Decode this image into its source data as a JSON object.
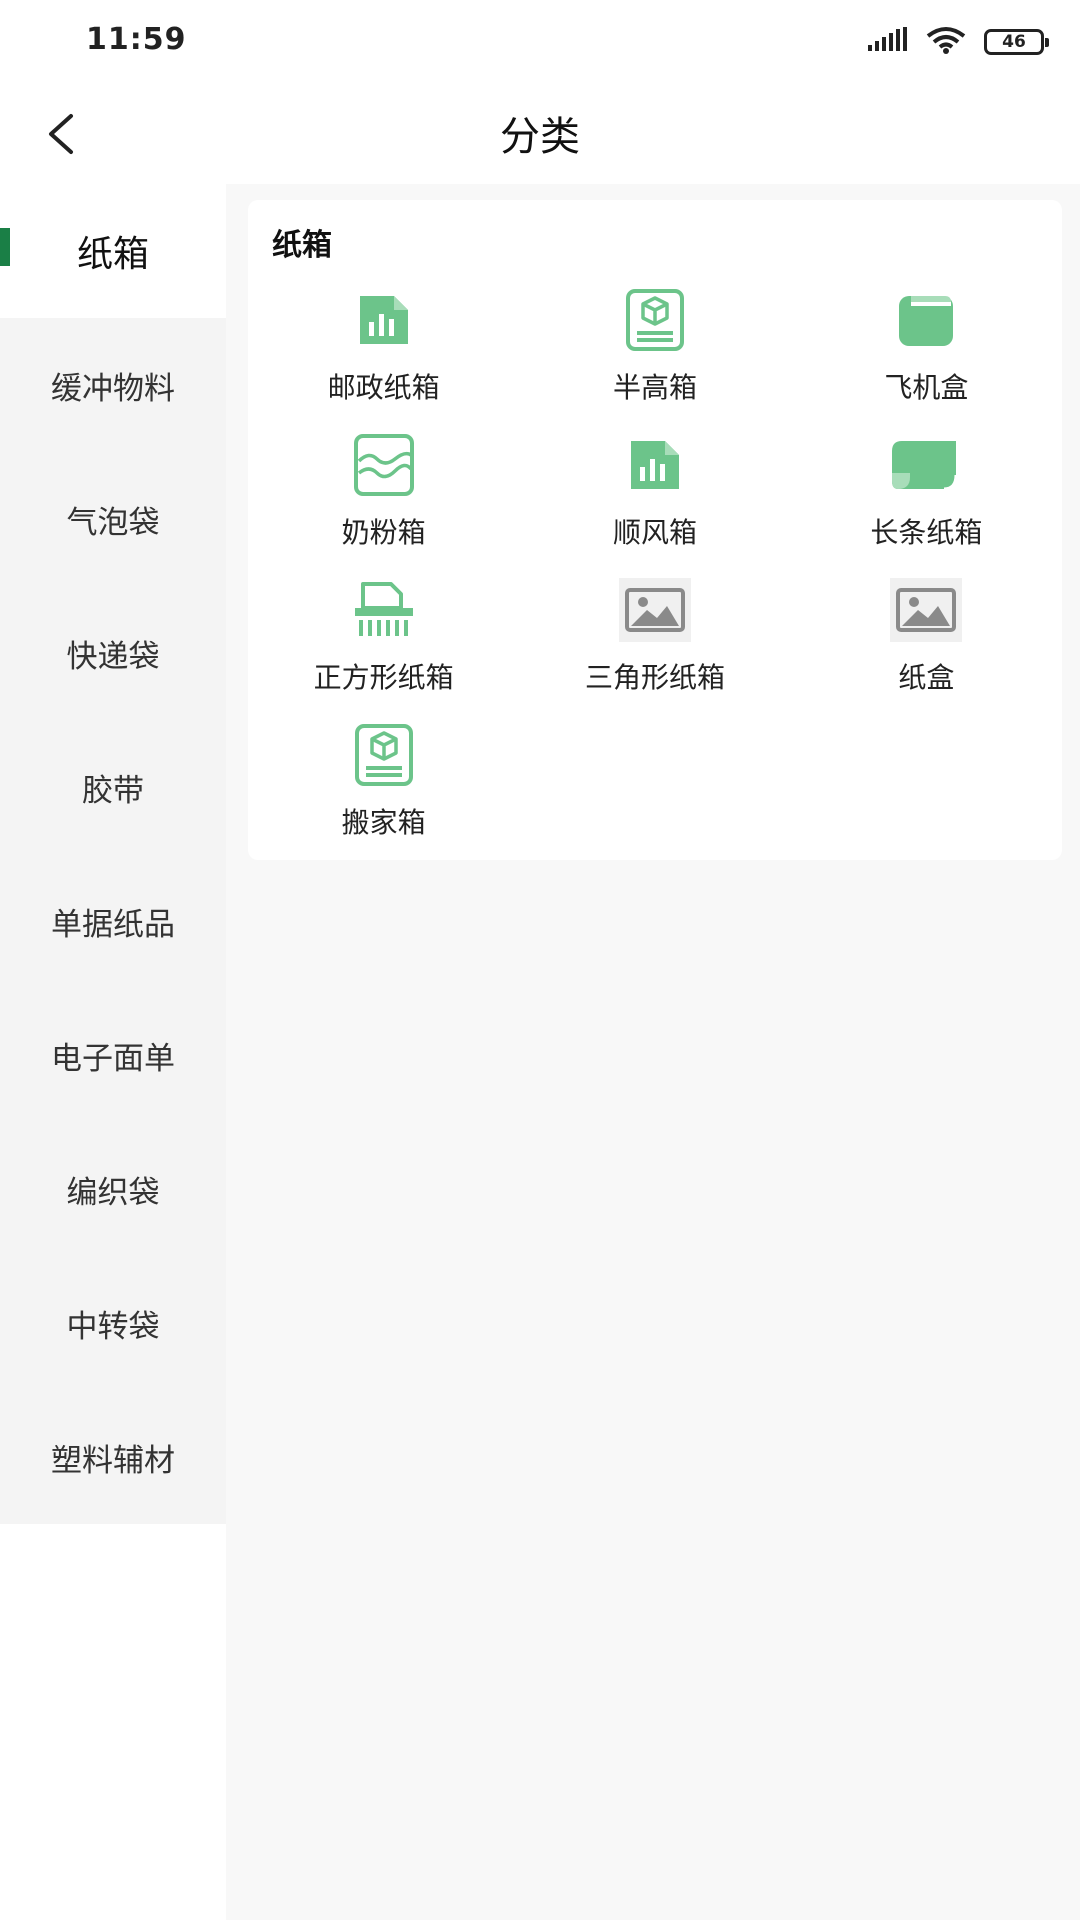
{
  "status_bar": {
    "time": "11:59",
    "battery": "46"
  },
  "header": {
    "title": "分类"
  },
  "sidebar": {
    "items": [
      {
        "label": "纸箱"
      },
      {
        "label": "缓冲物料"
      },
      {
        "label": "气泡袋"
      },
      {
        "label": "快递袋"
      },
      {
        "label": "胶带"
      },
      {
        "label": "单据纸品"
      },
      {
        "label": "电子面单"
      },
      {
        "label": "编织袋"
      },
      {
        "label": "中转袋"
      },
      {
        "label": "塑料辅材"
      }
    ]
  },
  "category": {
    "title": "纸箱",
    "items": [
      {
        "label": "邮政纸箱",
        "icon": "chart-doc-icon"
      },
      {
        "label": "半高箱",
        "icon": "box-doc-icon"
      },
      {
        "label": "飞机盒",
        "icon": "book-icon"
      },
      {
        "label": "奶粉箱",
        "icon": "wave-picture-icon"
      },
      {
        "label": "顺风箱",
        "icon": "chart-doc-icon"
      },
      {
        "label": "长条纸箱",
        "icon": "scroll-icon"
      },
      {
        "label": "正方形纸箱",
        "icon": "shredder-icon"
      },
      {
        "label": "三角形纸箱",
        "icon": "image-placeholder-icon"
      },
      {
        "label": "纸盒",
        "icon": "image-placeholder-icon"
      },
      {
        "label": "搬家箱",
        "icon": "box-doc-icon"
      }
    ]
  },
  "colors": {
    "accent": "#1a7f46",
    "icon_green": "#6cc48a",
    "placeholder_gray": "#8a8a8a"
  }
}
